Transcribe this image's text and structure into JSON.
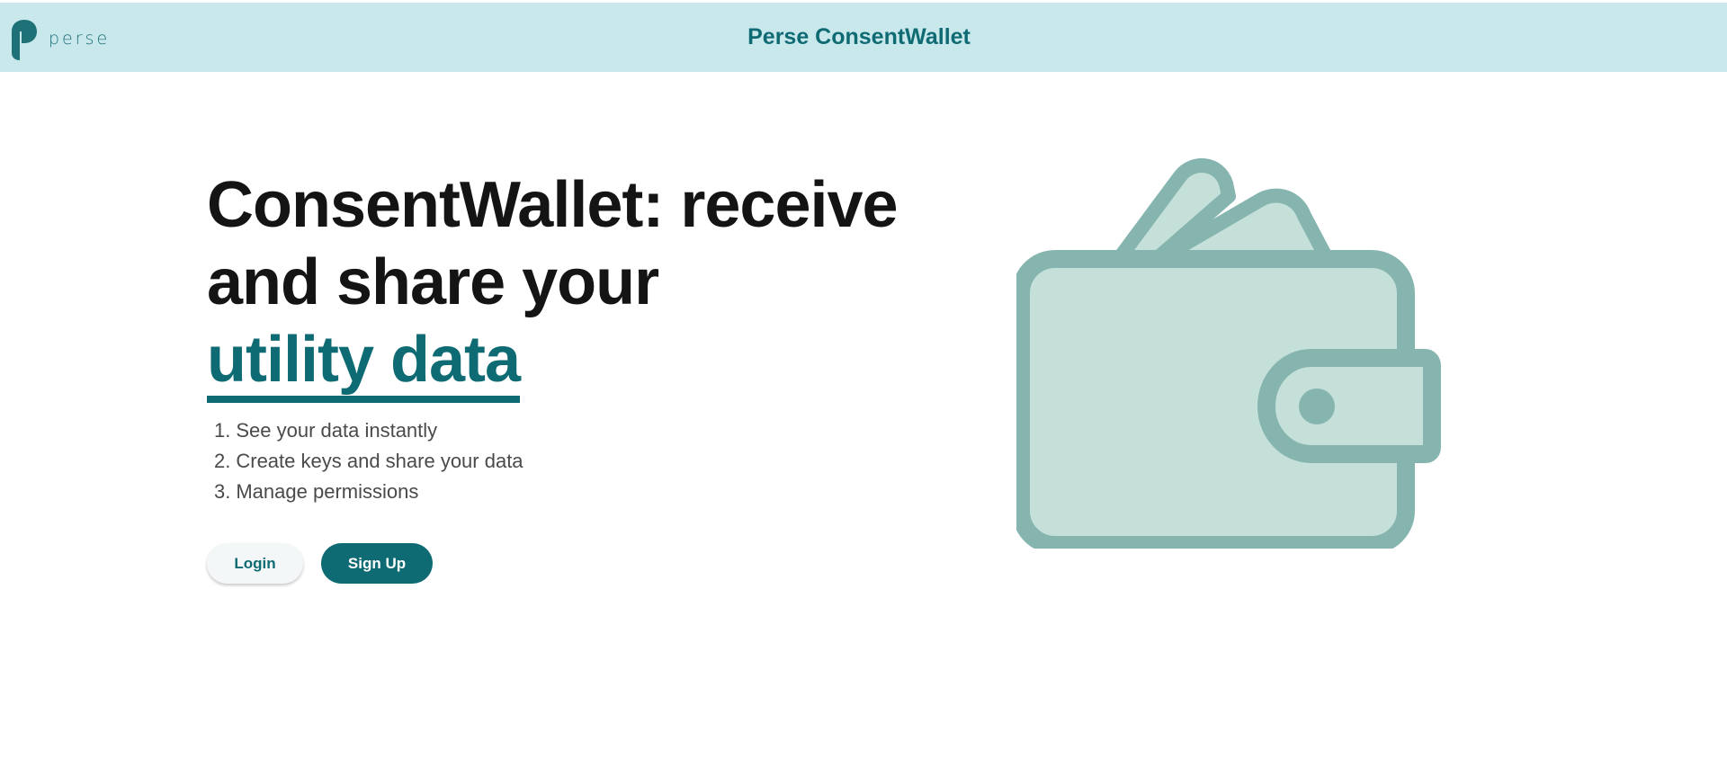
{
  "header": {
    "logo_text": "perse",
    "title": "Perse ConsentWallet"
  },
  "hero": {
    "headline_line1": "ConsentWallet: receive",
    "headline_line2": "and share your",
    "headline_highlight": "utility data",
    "features": [
      {
        "num": "1.",
        "text": "See your data instantly"
      },
      {
        "num": "2.",
        "text": "Create keys and share your data"
      },
      {
        "num": "3.",
        "text": "Manage permissions"
      }
    ]
  },
  "actions": {
    "login_label": "Login",
    "signup_label": "Sign Up"
  },
  "illustration": {
    "icon": "wallet-icon"
  },
  "colors": {
    "brand": "#0f6b73",
    "header_bg": "#c8e8ec",
    "wallet_outline": "#86b5b0",
    "wallet_fill": "#c5e0d9"
  }
}
